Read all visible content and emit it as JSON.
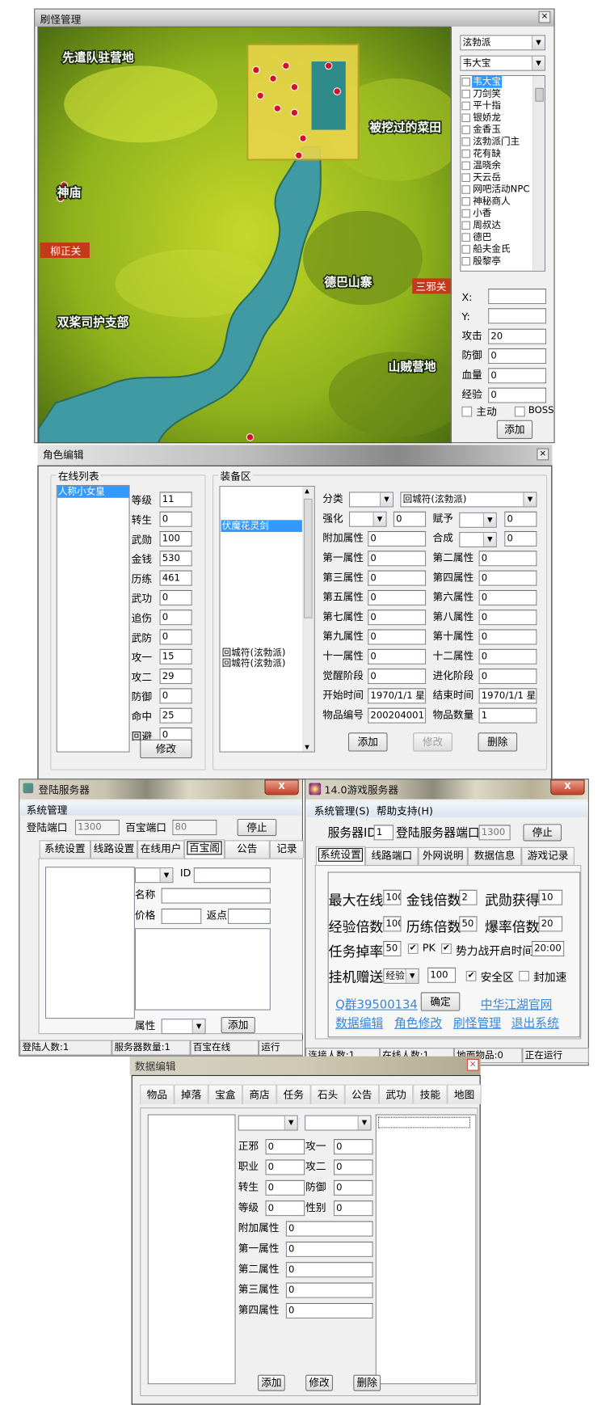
{
  "monster_window": {
    "title": "刷怪管理",
    "close_icon": "close-icon",
    "map_labels": [
      "先遣队驻营地",
      "被挖过的菜田",
      "神庙",
      "双桨司护支部",
      "德巴山寨",
      "山贼营地"
    ],
    "map_gates": [
      "柳正关",
      "三邪关"
    ],
    "faction": "泫勃派",
    "npc": "韦大宝",
    "npc_list": [
      "韦大宝",
      "刀剑笑",
      "平十指",
      "银娇龙",
      "金香玉",
      "泫勃派门主",
      "花有缺",
      "温晓余",
      "天云岳",
      "网吧活动NPC",
      "神秘商人",
      "小香",
      "周叔达",
      "德巴",
      "船夫金氏",
      "殷黎亭"
    ],
    "x_label": "X:",
    "x_value": "",
    "y_label": "Y:",
    "y_value": "",
    "fields": [
      {
        "label": "攻击",
        "value": "20"
      },
      {
        "label": "防御",
        "value": "0"
      },
      {
        "label": "血量",
        "value": "0"
      },
      {
        "label": "经验",
        "value": "0"
      }
    ],
    "active_label": "主动",
    "boss_label": "BOSS",
    "add_label": "添加"
  },
  "role_window": {
    "title": "角色编辑",
    "close_icon": "close-icon",
    "online_group": "在线列表",
    "online_list": [
      "人称小女皇"
    ],
    "stats": [
      {
        "label": "等级",
        "value": "11"
      },
      {
        "label": "转生",
        "value": "0"
      },
      {
        "label": "武勋",
        "value": "100"
      },
      {
        "label": "金钱",
        "value": "530"
      },
      {
        "label": "历练",
        "value": "461"
      },
      {
        "label": "武功",
        "value": "0"
      },
      {
        "label": "追伤",
        "value": "0"
      },
      {
        "label": "武防",
        "value": "0"
      },
      {
        "label": "攻一",
        "value": "15"
      },
      {
        "label": "攻二",
        "value": "29"
      },
      {
        "label": "防御",
        "value": "0"
      },
      {
        "label": "命中",
        "value": "25"
      },
      {
        "label": "回避",
        "value": "0"
      }
    ],
    "modify_label": "修改",
    "equip_group": "装备区",
    "equip_list": [
      "伏魔花灵剑",
      "回城符(泫勃派)",
      "回城符(泫勃派)"
    ],
    "category_label": "分类",
    "category_value": "",
    "item_value": "回城符(泫勃派)",
    "enhance_label": "强化",
    "enhance_combo": "",
    "enhance_value": "0",
    "grant_label": "赋予",
    "grant_combo": "",
    "grant_value": "0",
    "extra_label": "附加属性",
    "extra_value": "0",
    "combine_label": "合成",
    "combine_combo": "",
    "combine_value": "0",
    "attr_pairs": [
      [
        {
          "label": "第一属性",
          "value": "0"
        },
        {
          "label": "第二属性",
          "value": "0"
        }
      ],
      [
        {
          "label": "第三属性",
          "value": "0"
        },
        {
          "label": "第四属性",
          "value": "0"
        }
      ],
      [
        {
          "label": "第五属性",
          "value": "0"
        },
        {
          "label": "第六属性",
          "value": "0"
        }
      ],
      [
        {
          "label": "第七属性",
          "value": "0"
        },
        {
          "label": "第八属性",
          "value": "0"
        }
      ],
      [
        {
          "label": "第九属性",
          "value": "0"
        },
        {
          "label": "第十属性",
          "value": "0"
        }
      ],
      [
        {
          "label": "十一属性",
          "value": "0"
        },
        {
          "label": "十二属性",
          "value": "0"
        }
      ],
      [
        {
          "label": "觉醒阶段",
          "value": "0"
        },
        {
          "label": "进化阶段",
          "value": "0"
        }
      ],
      [
        {
          "label": "开始时间",
          "value": "1970/1/1 星期"
        },
        {
          "label": "结束时间",
          "value": "1970/1/1 星期"
        }
      ],
      [
        {
          "label": "物品编号",
          "value": "200204001"
        },
        {
          "label": "物品数量",
          "value": "1"
        }
      ]
    ],
    "add_label": "添加",
    "modify2_label": "修改",
    "delete_label": "删除"
  },
  "login_window": {
    "title": "登陆服务器",
    "menu": "系统管理",
    "login_port_label": "登陆端口",
    "login_port": "1300",
    "bao_port_label": "百宝端口",
    "bao_port": "80",
    "stop_label": "停止",
    "tabs": [
      "系统设置",
      "线路设置",
      "在线用户",
      "百宝阁",
      "公告",
      "记录"
    ],
    "active_tab": "百宝阁",
    "id_label": "ID",
    "id_value": "",
    "name_label": "名称",
    "name_value": "",
    "price_label": "价格",
    "price_value": "",
    "rebate_label": "返点",
    "rebate_value": "",
    "attr_label": "属性",
    "add_label": "添加",
    "status": [
      "登陆人数:1",
      "服务器数量:1",
      "百宝在线",
      "运行"
    ]
  },
  "game_window": {
    "title": "14.0游戏服务器",
    "menus": [
      "系统管理(S)",
      "帮助支持(H)"
    ],
    "server_id_label": "服务器ID",
    "server_id": "1",
    "login_port_label": "登陆服务器端口",
    "login_port": "1300",
    "stop_label": "停止",
    "tabs": [
      "系统设置",
      "线路端口",
      "外网说明",
      "数据信息",
      "游戏记录"
    ],
    "active_tab": "系统设置",
    "max_online_label": "最大在线",
    "max_online": "100",
    "money_rate_label": "金钱倍数",
    "money_rate": "2",
    "honor_label": "武勋获得",
    "honor": "10",
    "exp_rate_label": "经验倍数",
    "exp_rate": "100",
    "train_rate_label": "历练倍数",
    "train_rate": "50",
    "drop_rate_label": "爆率倍数",
    "drop_rate": "20",
    "quest_drop_label": "任务掉率",
    "quest_drop": "50",
    "pk_label": "PK",
    "pk_checked": true,
    "faction_war_label": "势力战开启时间",
    "faction_war_checked": true,
    "faction_war_time": "20:00",
    "idle_label": "挂机赠送",
    "idle_type": "经验",
    "idle_amount": "100",
    "safe_zone_label": "安全区",
    "safe_zone_checked": true,
    "anti_speed_label": "封加速",
    "anti_speed_checked": false,
    "qq_link": "Q群39500134",
    "confirm_label": "确定",
    "site_link": "中华江湖官网",
    "links": [
      "数据编辑",
      "角色修改",
      "刷怪管理",
      "退出系统"
    ],
    "status": [
      "连接人数:1",
      "在线人数:1",
      "地面物品:0",
      "正在运行"
    ]
  },
  "data_window": {
    "title": "数据编辑",
    "close_icon": "close-icon",
    "tabs": [
      "物品",
      "掉落",
      "宝盒",
      "商店",
      "任务",
      "石头",
      "公告",
      "武功",
      "技能",
      "地图"
    ],
    "pair_rows": [
      [
        {
          "label": "正邪",
          "value": "0"
        },
        {
          "label": "攻一",
          "value": "0"
        }
      ],
      [
        {
          "label": "职业",
          "value": "0"
        },
        {
          "label": "攻二",
          "value": "0"
        }
      ],
      [
        {
          "label": "转生",
          "value": "0"
        },
        {
          "label": "防御",
          "value": "0"
        }
      ],
      [
        {
          "label": "等级",
          "value": "0"
        },
        {
          "label": "性别",
          "value": "0"
        }
      ]
    ],
    "attrs": [
      {
        "label": "附加属性",
        "value": "0"
      },
      {
        "label": "第一属性",
        "value": "0"
      },
      {
        "label": "第二属性",
        "value": "0"
      },
      {
        "label": "第三属性",
        "value": "0"
      },
      {
        "label": "第四属性",
        "value": "0"
      }
    ],
    "add_label": "添加",
    "modify_label": "修改",
    "delete_label": "删除"
  }
}
